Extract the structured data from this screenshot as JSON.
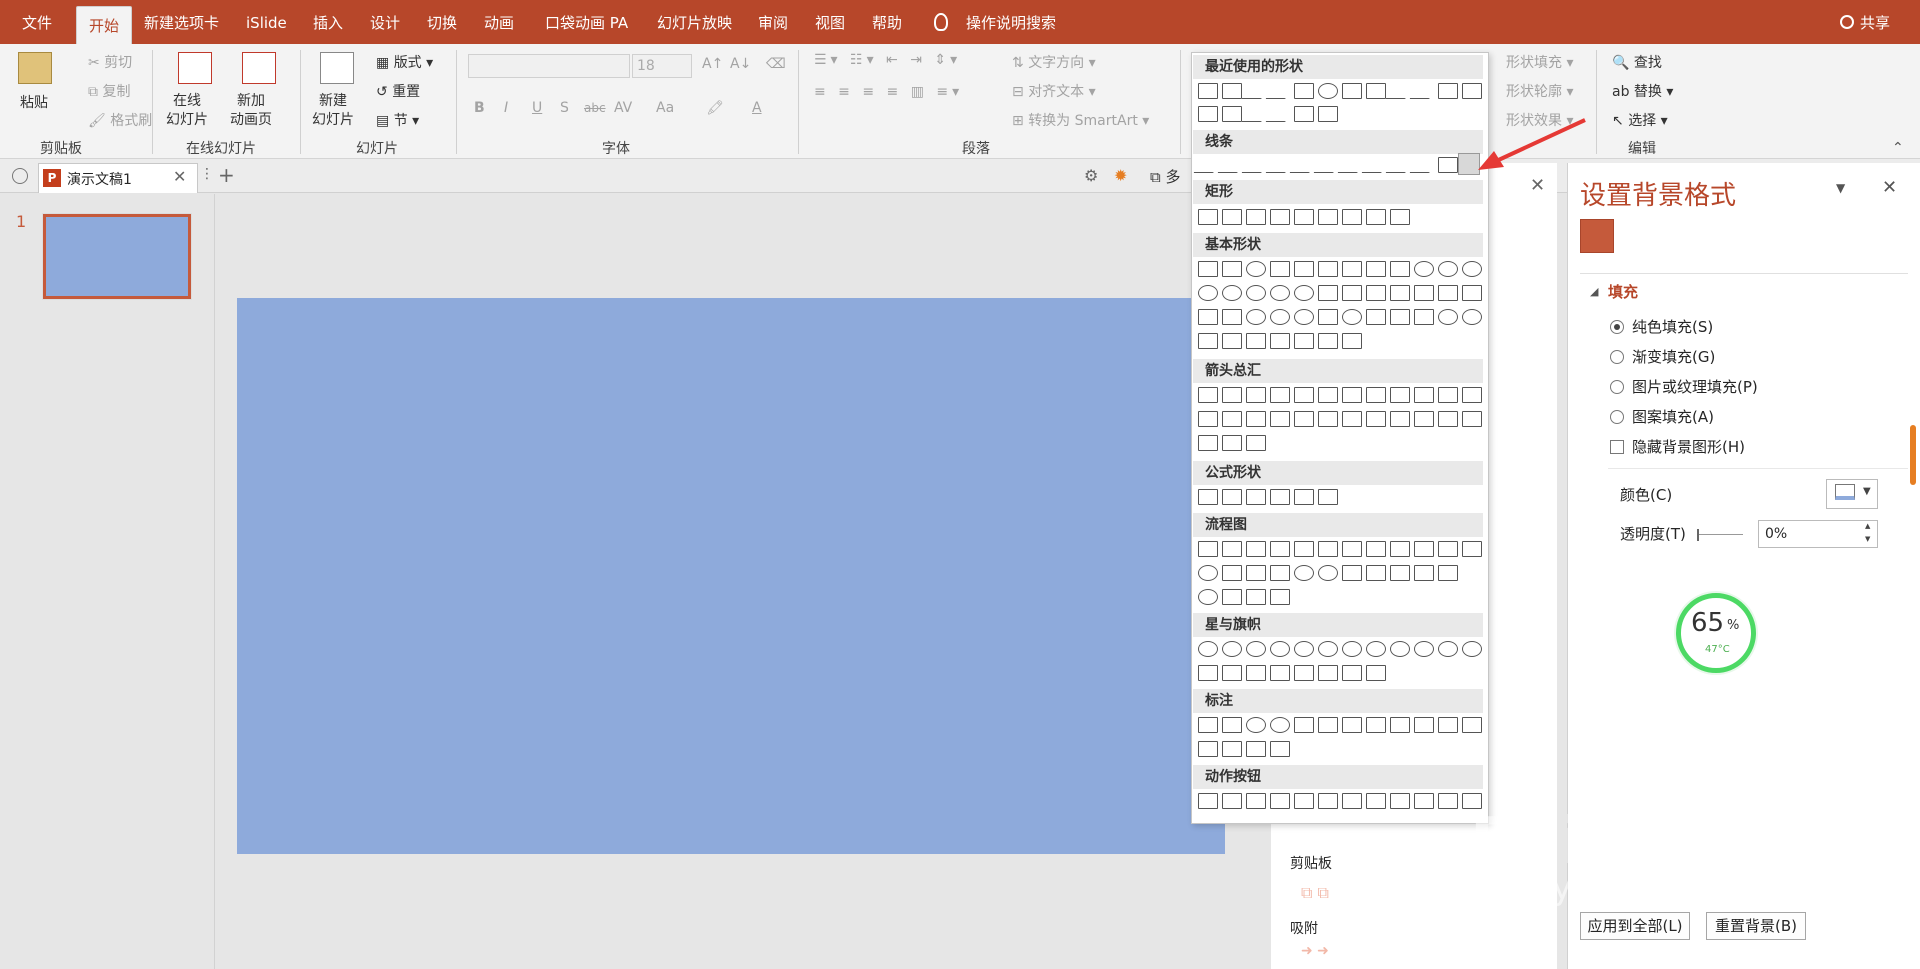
{
  "menu": {
    "tabs": [
      "文件",
      "开始",
      "新建选项卡",
      "iSlide",
      "插入",
      "设计",
      "切换",
      "动画",
      "口袋动画 PA",
      "幻灯片放映",
      "审阅",
      "视图",
      "帮助"
    ],
    "tell_me": "操作说明搜索",
    "share": "共享"
  },
  "ribbon": {
    "clipboard": {
      "paste": "粘贴",
      "cut": "剪切",
      "copy": "复制",
      "format_painter": "格式刷",
      "label": "剪贴板"
    },
    "online": {
      "online_slides": "在线\n幻灯片",
      "new_anim": "新加\n动画页",
      "label": "在线幻灯片"
    },
    "slides": {
      "new_slide": "新建\n幻灯片",
      "layout": "版式",
      "reset": "重置",
      "section": "节",
      "label": "幻灯片"
    },
    "font": {
      "size": "18",
      "label": "字体",
      "bold": "B",
      "italic": "I",
      "underline": "U",
      "strike": "S",
      "abc": "abc",
      "av": "AV",
      "aa": "Aa",
      "a": "A"
    },
    "paragraph": {
      "text_dir": "文字方向",
      "align_text": "对齐文本",
      "smartart": "转换为 SmartArt",
      "label": "段落"
    },
    "drawing": {
      "shape_fill": "形状填充",
      "shape_outline": "形状轮廓",
      "shape_effect": "形状效果"
    },
    "editing": {
      "find": "查找",
      "replace": "替换",
      "select": "选择",
      "label": "编辑"
    }
  },
  "doc": {
    "tab_title": "演示文稿1",
    "more": "多"
  },
  "thumbs": {
    "slide_number": "1"
  },
  "shapes_menu": {
    "sections": [
      "最近使用的形状",
      "线条",
      "矩形",
      "基本形状",
      "箭头总汇",
      "公式形状",
      "流程图",
      "星与旗帜",
      "标注",
      "动作按钮"
    ]
  },
  "mid_panel": {
    "clipboard": "剪贴板",
    "snap": "吸附"
  },
  "format_panel": {
    "title": "设置背景格式",
    "fill_section": "填充",
    "options": [
      "纯色填充(S)",
      "渐变填充(G)",
      "图片或纹理填充(P)",
      "图案填充(A)"
    ],
    "hide_bg": "隐藏背景图形(H)",
    "color_label": "颜色(C)",
    "transparency_label": "透明度(T)",
    "transparency_value": "0%",
    "apply_all": "应用到全部(L)",
    "reset_bg": "重置背景(B)"
  },
  "widget": {
    "percent": "65",
    "unit": "%",
    "temp": "47°C"
  },
  "watermark": {
    "brand": "Baidu",
    "cn": "经验",
    "url": "jingyan.baidu.com"
  },
  "colors": {
    "accent": "#b7472a",
    "slide": "#8eaadb",
    "arrow": "#e53935"
  }
}
